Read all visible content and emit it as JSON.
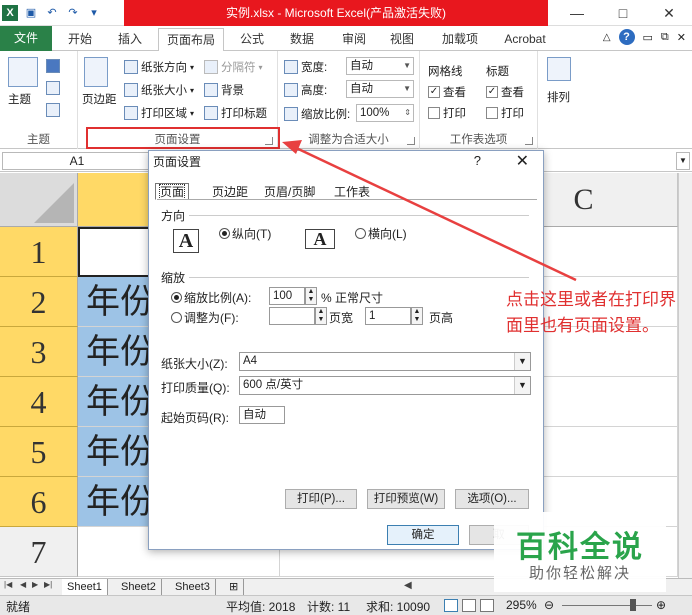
{
  "titlebar": {
    "title": "实例.xlsx - Microsoft Excel(产品激活失败)",
    "xl_icon": "X",
    "minimize": "—",
    "maximize": "□",
    "close": "✕"
  },
  "tabs": {
    "file": "文件",
    "items": [
      "开始",
      "插入",
      "页面布局",
      "公式",
      "数据",
      "审阅",
      "视图",
      "加载项",
      "Acrobat"
    ],
    "active": "页面布局"
  },
  "ribbon": {
    "theme": {
      "big": "主题",
      "label": "主题"
    },
    "page_setup": {
      "margins": "页边距",
      "orientation": "纸张方向",
      "size": "纸张大小",
      "print_area": "打印区域",
      "breaks": "分隔符",
      "background": "背景",
      "print_titles": "打印标题",
      "label": "页面设置"
    },
    "scale_to_fit": {
      "width_label": "宽度:",
      "width_value": "自动",
      "height_label": "高度:",
      "height_value": "自动",
      "scale_label": "缩放比例:",
      "scale_value": "100%",
      "label": "调整为合适大小"
    },
    "sheet_options": {
      "gridlines": "网格线",
      "headings": "标题",
      "view": "查看",
      "print": "打印",
      "label": "工作表选项"
    },
    "arrange": {
      "label": "排列"
    }
  },
  "formula_bar": {
    "name_box": "A1"
  },
  "sheet": {
    "col_c": "C",
    "rows": [
      "1",
      "2",
      "3",
      "4",
      "5",
      "6",
      "7"
    ],
    "cell_text": "年份",
    "tabs": [
      "Sheet1",
      "Sheet2",
      "Sheet3"
    ]
  },
  "status": {
    "ready": "就绪",
    "average": "平均值: 2018",
    "count": "计数: 11",
    "sum": "求和: 10090",
    "zoom": "295%"
  },
  "dialog": {
    "title": "页面设置",
    "help": "?",
    "close": "✕",
    "tabs": [
      "页面",
      "页边距",
      "页眉/页脚",
      "工作表"
    ],
    "orientation_label": "方向",
    "portrait": "纵向(T)",
    "landscape": "横向(L)",
    "orient_glyph": "A",
    "scaling_label": "缩放",
    "scale_to": "缩放比例(A):",
    "scale_value": "100",
    "scale_unit": "% 正常尺寸",
    "fit_to": "调整为(F):",
    "pages_wide": "页宽",
    "tall_value": "1",
    "pages_tall": "页高",
    "paper_size_label": "纸张大小(Z):",
    "paper_size": "A4",
    "print_quality_label": "打印质量(Q):",
    "print_quality": "600 点/英寸",
    "first_page_label": "起始页码(R):",
    "first_page": "自动",
    "print_btn": "打印(P)...",
    "preview_btn": "打印预览(W)",
    "options_btn": "选项(O)...",
    "ok_btn": "确定",
    "cancel_btn": "取"
  },
  "annotation": {
    "text": "点击这里或者在打印界面里也有页面设置。"
  },
  "watermark": {
    "title": "百科全说",
    "subtitle": "助你轻松解决"
  },
  "colors": {
    "title_red": "#e8171e",
    "file_green": "#2a8148",
    "header_yellow": "#ffd966",
    "cell_blue": "#9dc3e6",
    "annot_red": "#e03030",
    "wm_green": "#2aa44b"
  }
}
